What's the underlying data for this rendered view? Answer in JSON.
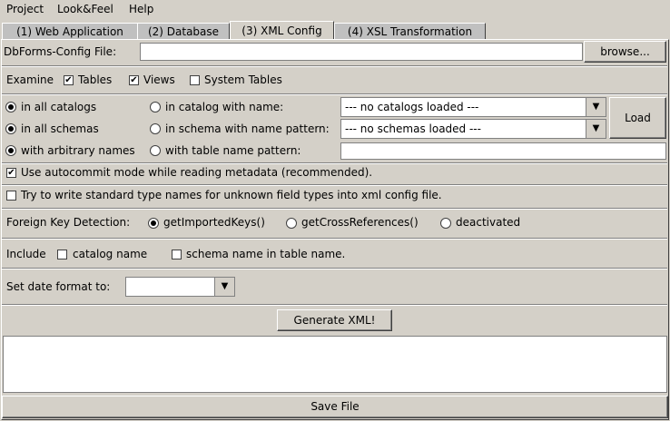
{
  "menu": {
    "items": [
      {
        "label": "Project"
      },
      {
        "label": "Look&Feel"
      },
      {
        "label": "Help"
      }
    ]
  },
  "tabs": [
    {
      "label": "(1) Web Application"
    },
    {
      "label": "(2) Database"
    },
    {
      "label": "(3) XML Config",
      "active": true
    },
    {
      "label": "(4) XSL Transformation"
    }
  ],
  "config_file": {
    "label": "DbForms-Config File:",
    "value": "",
    "browse_label": "browse..."
  },
  "examine": {
    "label": "Examine",
    "tables": "Tables",
    "views": "Views",
    "system_tables": "System Tables",
    "tables_checked": true,
    "views_checked": true,
    "system_checked": false
  },
  "catalogs": {
    "all": "in all catalogs",
    "with_name": "in catalog with name:",
    "combo_value": "--- no catalogs loaded ---"
  },
  "schemas": {
    "all": "in all schemas",
    "with_pattern": "in schema with name pattern:",
    "combo_value": "--- no schemas loaded ---"
  },
  "names": {
    "arbitrary": "with arbitrary names",
    "with_pattern": "with table name pattern:",
    "value": ""
  },
  "load_label": "Load",
  "autocommit": {
    "label": "Use autocommit mode while reading metadata (recommended).",
    "checked": true
  },
  "std_types": {
    "label": "Try to write standard type names for unknown field types into xml config file.",
    "checked": false
  },
  "fk": {
    "label": "Foreign Key Detection:",
    "opt1": "getImportedKeys()",
    "opt2": "getCrossReferences()",
    "opt3": "deactivated"
  },
  "include": {
    "label": "Include",
    "catalog": "catalog name",
    "schema": "schema name  in table name."
  },
  "date_format": {
    "label": "Set date format to:",
    "value": ""
  },
  "generate_label": "Generate XML!",
  "output_text": "",
  "save_label": "Save File",
  "icons": {
    "checked": "check-mark",
    "combo_arrow": "triangle-down"
  }
}
